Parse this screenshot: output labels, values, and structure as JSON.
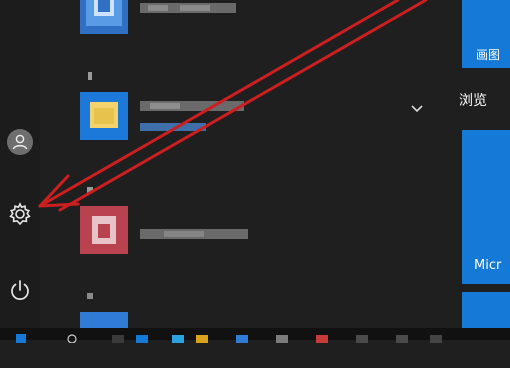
{
  "tiles": {
    "tile1_label": "画图",
    "group_label": "浏览",
    "tile2_label": "Micr"
  },
  "colors": {
    "accent": "#1479d7",
    "annotation_arrow": "#cc1f1f",
    "background": "#1f1f1f"
  },
  "icons": {
    "user": "user-icon",
    "settings": "gear-icon",
    "power": "power-icon",
    "expand": "chevron-down-icon"
  }
}
